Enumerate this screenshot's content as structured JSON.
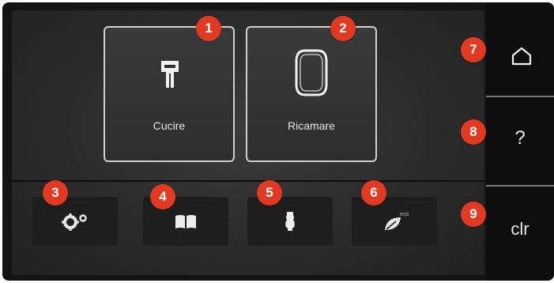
{
  "mode_buttons": {
    "sewing": {
      "label": "Cucire",
      "icon": "presser-foot-icon",
      "badge": "1"
    },
    "embroidery": {
      "label": "Ricamare",
      "icon": "embroidery-hoop-icon",
      "badge": "2"
    }
  },
  "tool_buttons": [
    {
      "icon": "settings-gears-icon",
      "badge": "3"
    },
    {
      "icon": "help-book-icon",
      "badge": "4"
    },
    {
      "icon": "sewing-guide-icon",
      "badge": "5"
    },
    {
      "icon": "eco-mode-icon",
      "badge": "6",
      "label": "eco"
    }
  ],
  "side_buttons": {
    "home": {
      "icon": "home-icon",
      "badge": "7"
    },
    "help": {
      "label": "?",
      "badge": "8"
    },
    "clear": {
      "label": "clr",
      "badge": "9"
    }
  },
  "colors": {
    "badge": "#e23a22",
    "screen_background": "#141414",
    "panel_background": "#2b2b2b",
    "text": "#e8e8e8"
  }
}
